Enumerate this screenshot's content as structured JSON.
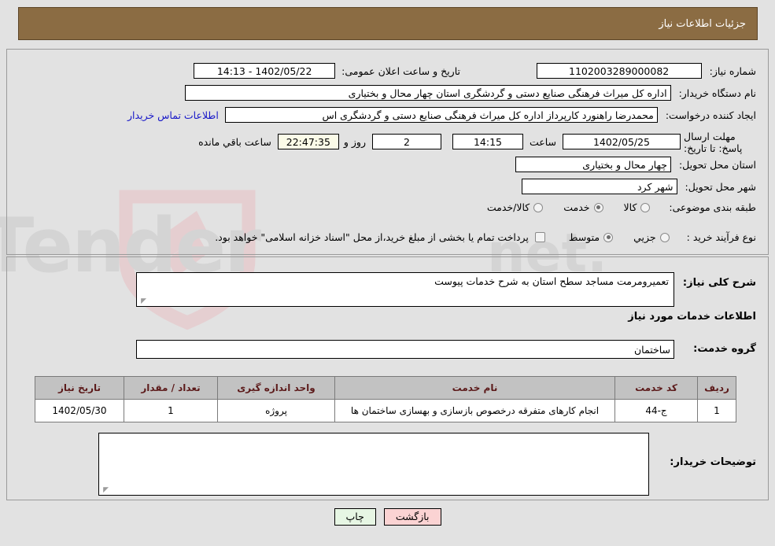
{
  "header": {
    "title": "جزئیات اطلاعات نیاز"
  },
  "form": {
    "need_number_label": "شماره نیاز:",
    "need_number_value": "1102003289000082",
    "announce_datetime_label": "تاریخ و ساعت اعلان عمومی:",
    "announce_datetime_value": "1402/05/22 - 14:13",
    "buyer_org_label": "نام دستگاه خریدار:",
    "buyer_org_value": "اداره کل میراث فرهنگی  صنایع دستی و گردشگری استان چهار محال و بختیاری",
    "creator_label": "ایجاد کننده درخواست:",
    "creator_value": "محمدرضا راهنورد کارپرداز اداره کل میراث فرهنگی  صنایع دستی و گردشگری اس",
    "contact_link": "اطلاعات تماس خریدار",
    "deadline_label": "مهلت ارسال پاسخ: تا تاریخ:",
    "deadline_date": "1402/05/25",
    "deadline_time_label": "ساعت",
    "deadline_time": "14:15",
    "days_value": "2",
    "days_label": "روز و",
    "countdown_value": "22:47:35",
    "countdown_label": "ساعت باقي مانده",
    "province_label": "استان محل تحویل:",
    "province_value": "چهار محال و بختیاری",
    "city_label": "شهر محل تحویل:",
    "city_value": "شهر کرد",
    "category_label": "طبقه بندی موضوعی:",
    "category_options": [
      {
        "label": "کالا",
        "selected": false
      },
      {
        "label": "خدمت",
        "selected": true
      },
      {
        "label": "کالا/خدمت",
        "selected": false
      }
    ],
    "purchase_type_label": "نوع فرآیند خرید :",
    "purchase_type_options": [
      {
        "label": "جزیي",
        "selected": false
      },
      {
        "label": "متوسط",
        "selected": true
      }
    ],
    "treasury_checked": false,
    "treasury_note": "پرداخت تمام یا بخشی از مبلغ خرید،از محل \"اسناد خزانه اسلامی\" خواهد بود."
  },
  "details": {
    "general_desc_label": "شرح کلی نیاز:",
    "general_desc_value": "تعمیرومرمت مساجد سطح استان به شرح خدمات پیوست",
    "services_info_title": "اطلاعات خدمات مورد نیاز",
    "service_group_label": "گروه خدمت:",
    "service_group_value": "ساختمان",
    "buyer_notes_label": "توضیحات خریدار:",
    "buyer_notes_value": ""
  },
  "table": {
    "headers": [
      "ردیف",
      "کد خدمت",
      "نام خدمت",
      "واحد اندازه گیری",
      "تعداد / مقدار",
      "تاریخ نیاز"
    ],
    "rows": [
      {
        "row_no": "1",
        "service_code": "ج-44",
        "service_name": "انجام کارهای متفرقه درخصوص بازسازی و بهسازی ساختمان ها",
        "unit": "پروژه",
        "quantity": "1",
        "need_date": "1402/05/30"
      }
    ]
  },
  "buttons": {
    "print": "چاپ",
    "back": "بازگشت"
  },
  "watermark": {
    "text": "AriaTender.net",
    "shield_color": "#e8c3c6",
    "text_color": "#cccccc"
  },
  "colors": {
    "header_bg": "#8b6c43",
    "link": "#1616c8",
    "table_header_bg": "#c2c2c2",
    "table_header_text": "#5c1a1a",
    "print_btn_bg": "#e7f6e4",
    "back_btn_bg": "#fbd3d3",
    "countdown_bg": "#fbfbe8"
  }
}
